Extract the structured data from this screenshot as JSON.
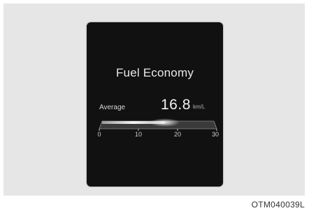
{
  "display": {
    "title": "Fuel Economy",
    "average_label": "Average",
    "average_value": "16.8",
    "average_unit": "km/L",
    "gauge": {
      "value": 16.8,
      "min": 0,
      "max": 30,
      "tick_labels": [
        "0",
        "10",
        "20",
        "30"
      ]
    }
  },
  "caption": "OTM040039L"
}
